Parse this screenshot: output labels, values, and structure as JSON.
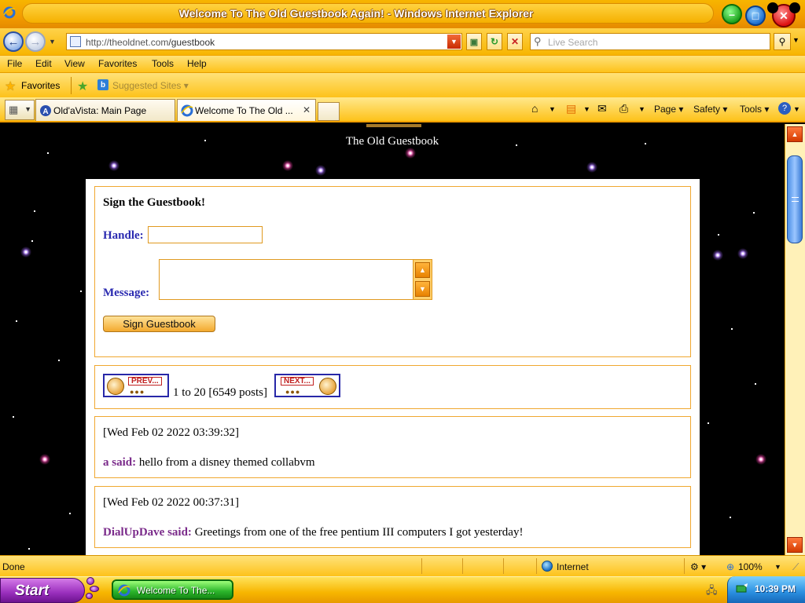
{
  "window": {
    "title": "Welcome To The Old Guestbook Again! - Windows Internet Explorer"
  },
  "address_bar": {
    "url_host": "http://theoldnet.com",
    "url_path": "/guestbook",
    "search_placeholder": "Live Search"
  },
  "menu": {
    "items": [
      "File",
      "Edit",
      "View",
      "Favorites",
      "Tools",
      "Help"
    ]
  },
  "favorites_bar": {
    "favorites_label": "Favorites",
    "suggested_label": "Suggested Sites"
  },
  "tabs": {
    "items": [
      {
        "label": "Old'aVista: Main Page"
      },
      {
        "label": "Welcome To The Old ..."
      }
    ],
    "command_page": "Page",
    "command_safety": "Safety",
    "command_tools": "Tools"
  },
  "page": {
    "header_title": "The Old Guestbook",
    "sign_heading": "Sign the Guestbook!",
    "handle_label": "Handle:",
    "message_label": "Message:",
    "sign_button": "Sign Guestbook",
    "prev_label": "PREV...",
    "next_label": "NEXT...",
    "pager_text": "1 to 20 [6549 posts]",
    "posts": [
      {
        "date": "[Wed Feb 02 2022 03:39:32]",
        "author": "a said:",
        "message": "hello from a disney themed collabvm"
      },
      {
        "date": "[Wed Feb 02 2022 00:37:31]",
        "author": "DialUpDave said:",
        "message": "Greetings from one of the free pentium III computers I got yesterday!"
      }
    ]
  },
  "status_bar": {
    "status": "Done",
    "zone": "Internet",
    "zoom": "100%"
  },
  "taskbar": {
    "start_label": "Start",
    "task_label": "Welcome To The...",
    "clock": "10:39 PM"
  },
  "colors": {
    "chrome_orange": "#f7b500",
    "link_blue": "#2a2ab0",
    "author_purple": "#7a2a8a",
    "box_border": "#f0a830"
  }
}
